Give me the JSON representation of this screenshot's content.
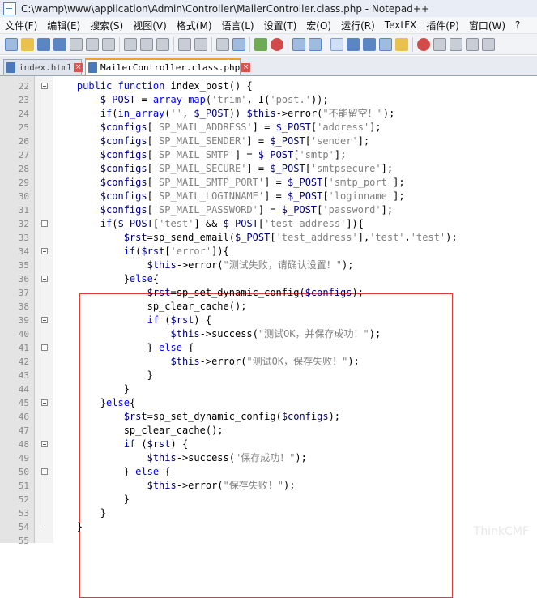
{
  "window": {
    "title": "C:\\wamp\\www\\application\\Admin\\Controller\\MailerController.class.php - Notepad++"
  },
  "menu": [
    "文件(F)",
    "编辑(E)",
    "搜索(S)",
    "视图(V)",
    "格式(M)",
    "语言(L)",
    "设置(T)",
    "宏(O)",
    "运行(R)",
    "TextFX",
    "插件(P)",
    "窗口(W)",
    "?"
  ],
  "tabs": [
    {
      "label": "index.html",
      "active": false
    },
    {
      "label": "MailerController.class.php",
      "active": true
    }
  ],
  "watermark": "ThinkCMF",
  "code_lines": [
    {
      "n": "22",
      "fold": "open",
      "t": "    public function index_post() {"
    },
    {
      "n": "23",
      "t": "        $_POST = array_map('trim', I('post.'));"
    },
    {
      "n": "24",
      "t": "        if(in_array('', $_POST)) $this->error(\"不能留空！\");"
    },
    {
      "n": "25",
      "t": "        $configs['SP_MAIL_ADDRESS'] = $_POST['address'];"
    },
    {
      "n": "26",
      "t": "        $configs['SP_MAIL_SENDER'] = $_POST['sender'];"
    },
    {
      "n": "27",
      "t": "        $configs['SP_MAIL_SMTP'] = $_POST['smtp'];"
    },
    {
      "n": "28",
      "t": "        $configs['SP_MAIL_SECURE'] = $_POST['smtpsecure'];"
    },
    {
      "n": "29",
      "t": "        $configs['SP_MAIL_SMTP_PORT'] = $_POST['smtp_port'];"
    },
    {
      "n": "30",
      "t": "        $configs['SP_MAIL_LOGINNAME'] = $_POST['loginname'];"
    },
    {
      "n": "31",
      "t": "        $configs['SP_MAIL_PASSWORD'] = $_POST['password'];"
    },
    {
      "n": "32",
      "fold": "open",
      "t": "        if($_POST['test'] && $_POST['test_address']){"
    },
    {
      "n": "33",
      "t": "            $rst=sp_send_email($_POST['test_address'],'test','test');"
    },
    {
      "n": "34",
      "fold": "open",
      "t": "            if($rst['error']){"
    },
    {
      "n": "35",
      "t": "                $this->error(\"测试失败，请确认设置！\");"
    },
    {
      "n": "36",
      "fold": "open",
      "t": "            }else{"
    },
    {
      "n": "37",
      "t": "                $rst=sp_set_dynamic_config($configs);"
    },
    {
      "n": "38",
      "t": "                sp_clear_cache();"
    },
    {
      "n": "39",
      "fold": "open",
      "t": "                if ($rst) {"
    },
    {
      "n": "40",
      "t": "                    $this->success(\"测试OK，并保存成功！\");"
    },
    {
      "n": "41",
      "fold": "open",
      "t": "                } else {"
    },
    {
      "n": "42",
      "t": "                    $this->error(\"测试OK，保存失败！\");"
    },
    {
      "n": "43",
      "t": "                }"
    },
    {
      "n": "44",
      "t": "            }"
    },
    {
      "n": "45",
      "fold": "open",
      "t": "        }else{"
    },
    {
      "n": "46",
      "t": "            $rst=sp_set_dynamic_config($configs);"
    },
    {
      "n": "47",
      "t": "            sp_clear_cache();"
    },
    {
      "n": "48",
      "fold": "open",
      "t": "            if ($rst) {"
    },
    {
      "n": "49",
      "t": "                $this->success(\"保存成功！\");"
    },
    {
      "n": "50",
      "fold": "open",
      "t": "            } else {"
    },
    {
      "n": "51",
      "t": "                $this->error(\"保存失败！\");"
    },
    {
      "n": "52",
      "t": "            }"
    },
    {
      "n": "53",
      "t": "        }"
    },
    {
      "n": "54",
      "t": "    }"
    },
    {
      "n": "55",
      "t": ""
    }
  ]
}
